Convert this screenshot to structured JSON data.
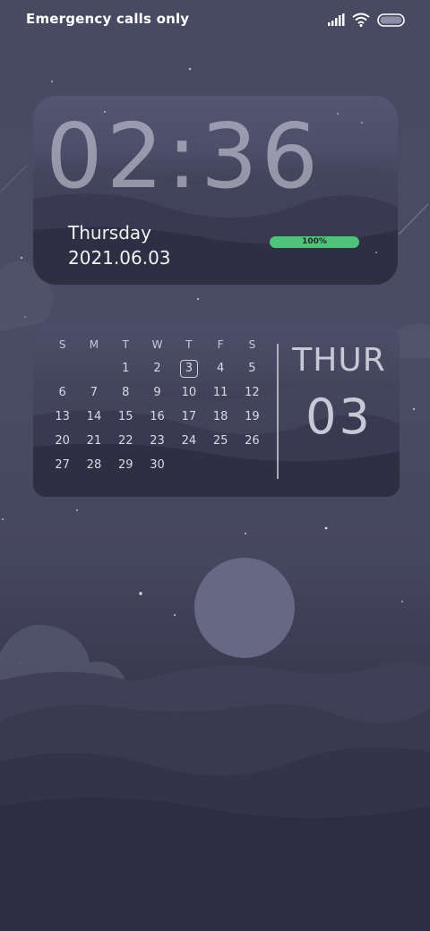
{
  "status_bar": {
    "carrier_text": "Emergency calls only",
    "icons": [
      "signal-icon",
      "wifi-icon",
      "battery-icon"
    ]
  },
  "clock_widget": {
    "time": "02:36",
    "day": "Thursday",
    "date": "2021.06.03",
    "battery_percent": "100%",
    "battery_level": 1.0,
    "battery_color": "#4fc37c"
  },
  "calendar_widget": {
    "weekday_headers": [
      "S",
      "M",
      "T",
      "W",
      "T",
      "F",
      "S"
    ],
    "weeks": [
      [
        "",
        "",
        "1",
        "2",
        "3",
        "4",
        "5"
      ],
      [
        "6",
        "7",
        "8",
        "9",
        "10",
        "11",
        "12"
      ],
      [
        "13",
        "14",
        "15",
        "16",
        "17",
        "18",
        "19"
      ],
      [
        "20",
        "21",
        "22",
        "23",
        "24",
        "25",
        "26"
      ],
      [
        "27",
        "28",
        "29",
        "30",
        "",
        "",
        ""
      ]
    ],
    "today": "3",
    "weekday_label": "THUR",
    "day_number": "03"
  },
  "colors": {
    "background_top": "#484a62",
    "background_bottom": "#2a2b3c",
    "moon": "#676883"
  }
}
